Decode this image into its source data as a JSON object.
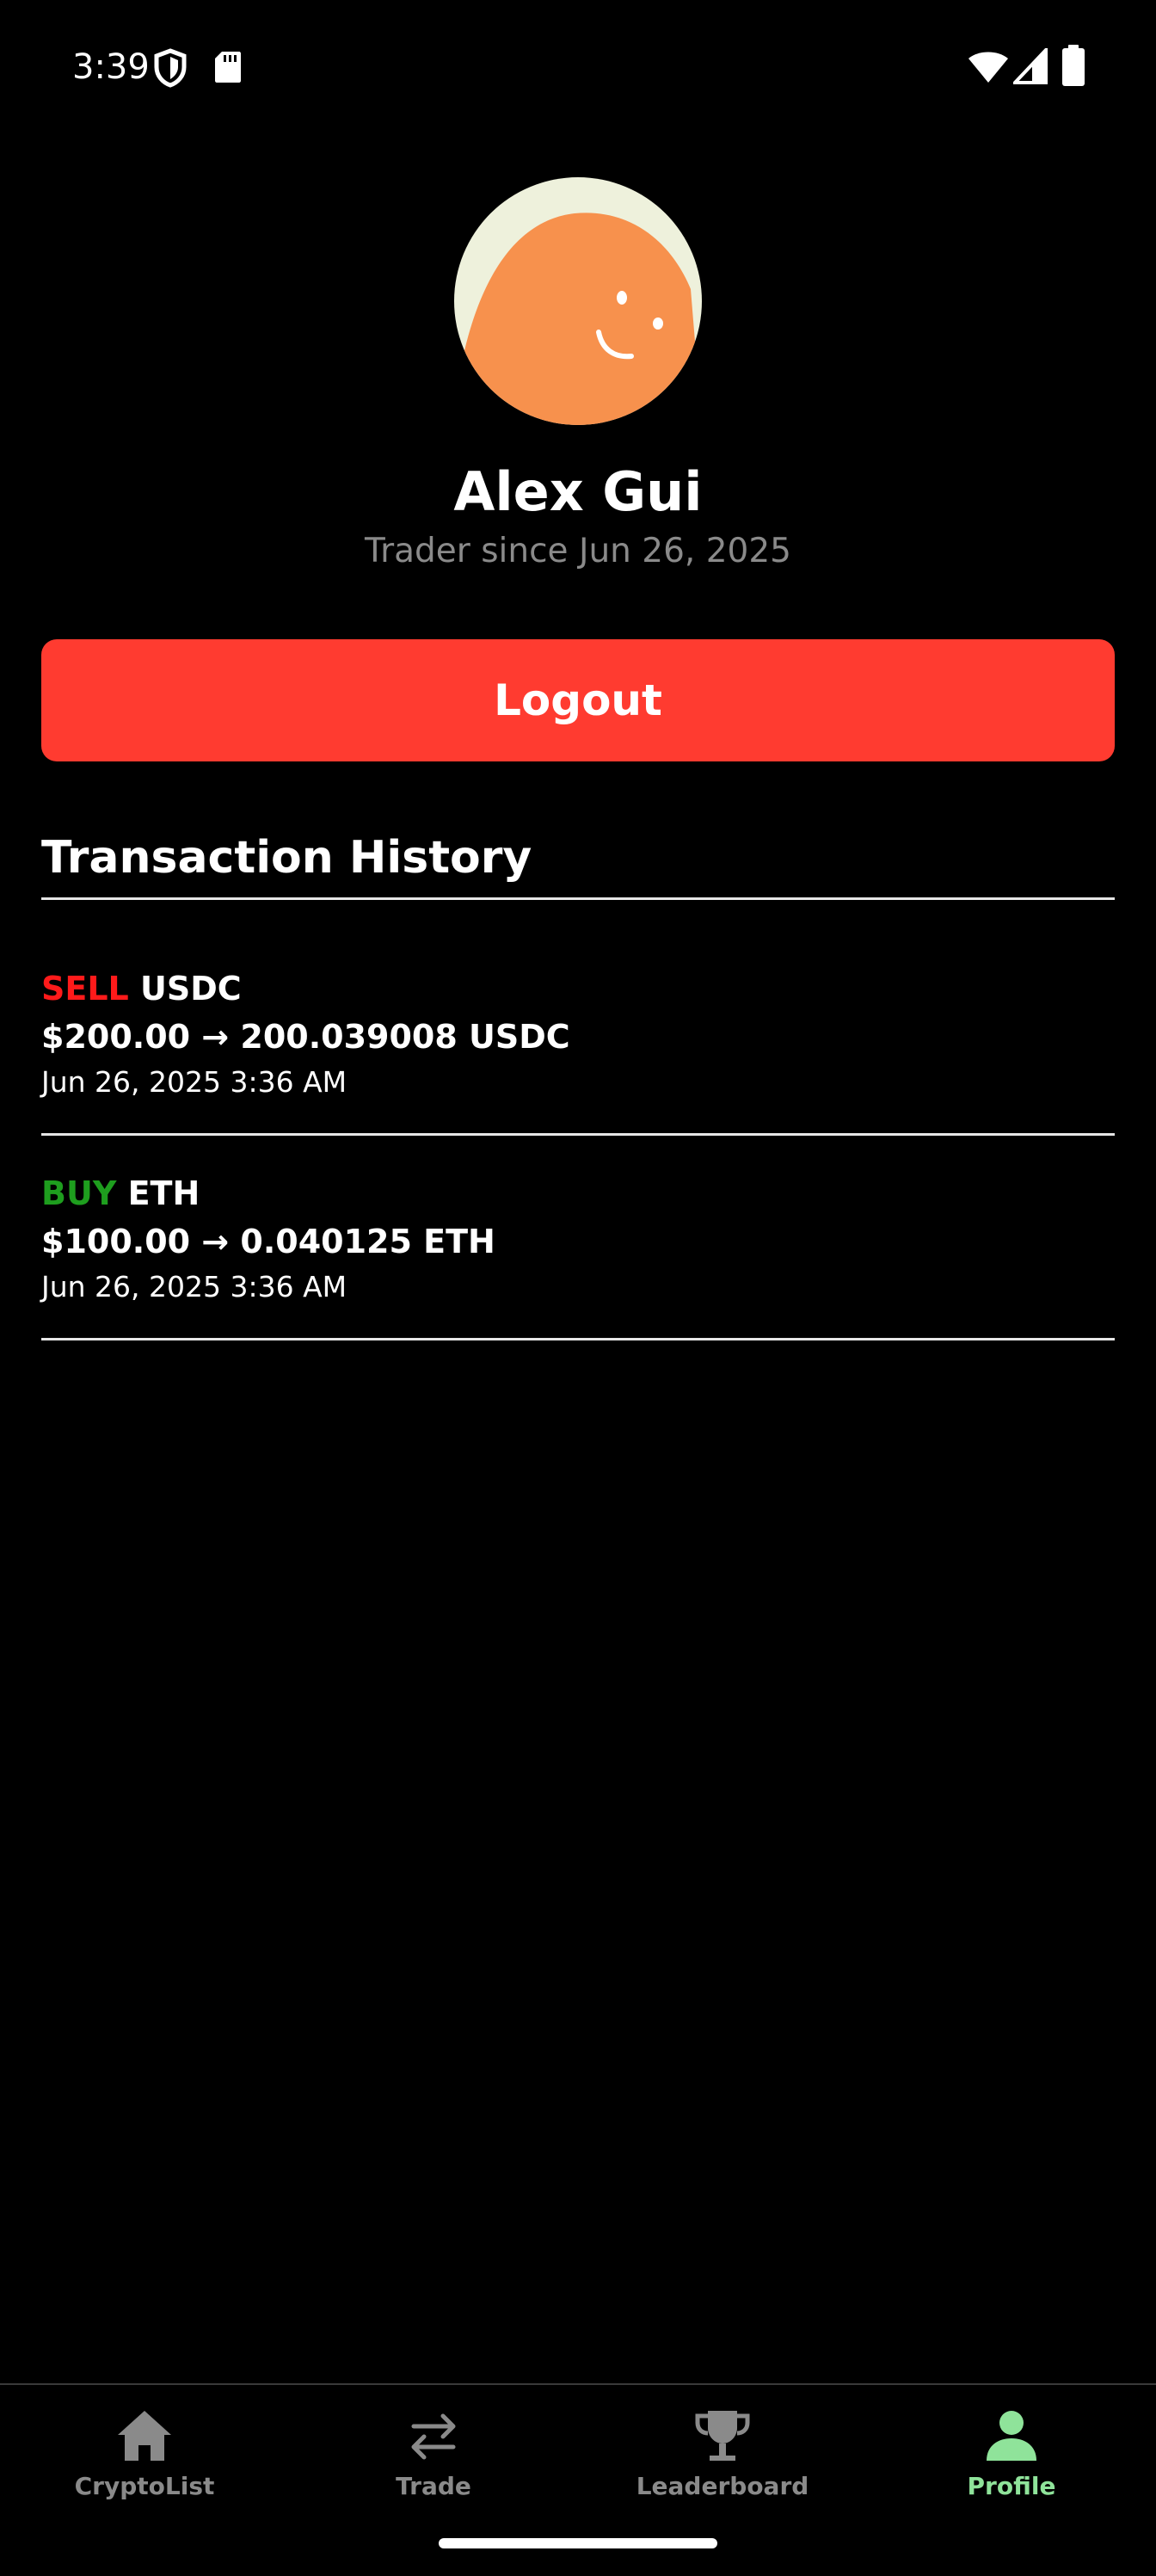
{
  "status_bar": {
    "time": "3:39",
    "icons": [
      "shield-icon",
      "sd-card-icon",
      "wifi-icon",
      "signal-icon",
      "battery-icon"
    ]
  },
  "profile": {
    "name": "Alex Gui",
    "trader_since": "Trader since Jun 26, 2025",
    "avatar": "avatar-orange-smile-icon"
  },
  "logout": {
    "label": "Logout",
    "color": "#ff3b30"
  },
  "transactions": {
    "title": "Transaction History",
    "items": [
      {
        "side": "SELL",
        "asset": "USDC",
        "amount": "$200.00 → 200.039008 USDC",
        "timestamp": "Jun 26, 2025 3:36 AM",
        "side_color": "#ff1a1a"
      },
      {
        "side": "BUY",
        "asset": "ETH",
        "amount": "$100.00 → 0.040125 ETH",
        "timestamp": "Jun 26, 2025 3:36 AM",
        "side_color": "#1e9e1e"
      }
    ]
  },
  "nav": {
    "active": "Profile",
    "active_color": "#8fe39a",
    "items": [
      {
        "label": "CryptoList",
        "icon": "home-icon"
      },
      {
        "label": "Trade",
        "icon": "swap-arrows-icon"
      },
      {
        "label": "Leaderboard",
        "icon": "trophy-icon"
      },
      {
        "label": "Profile",
        "icon": "person-icon"
      }
    ]
  }
}
